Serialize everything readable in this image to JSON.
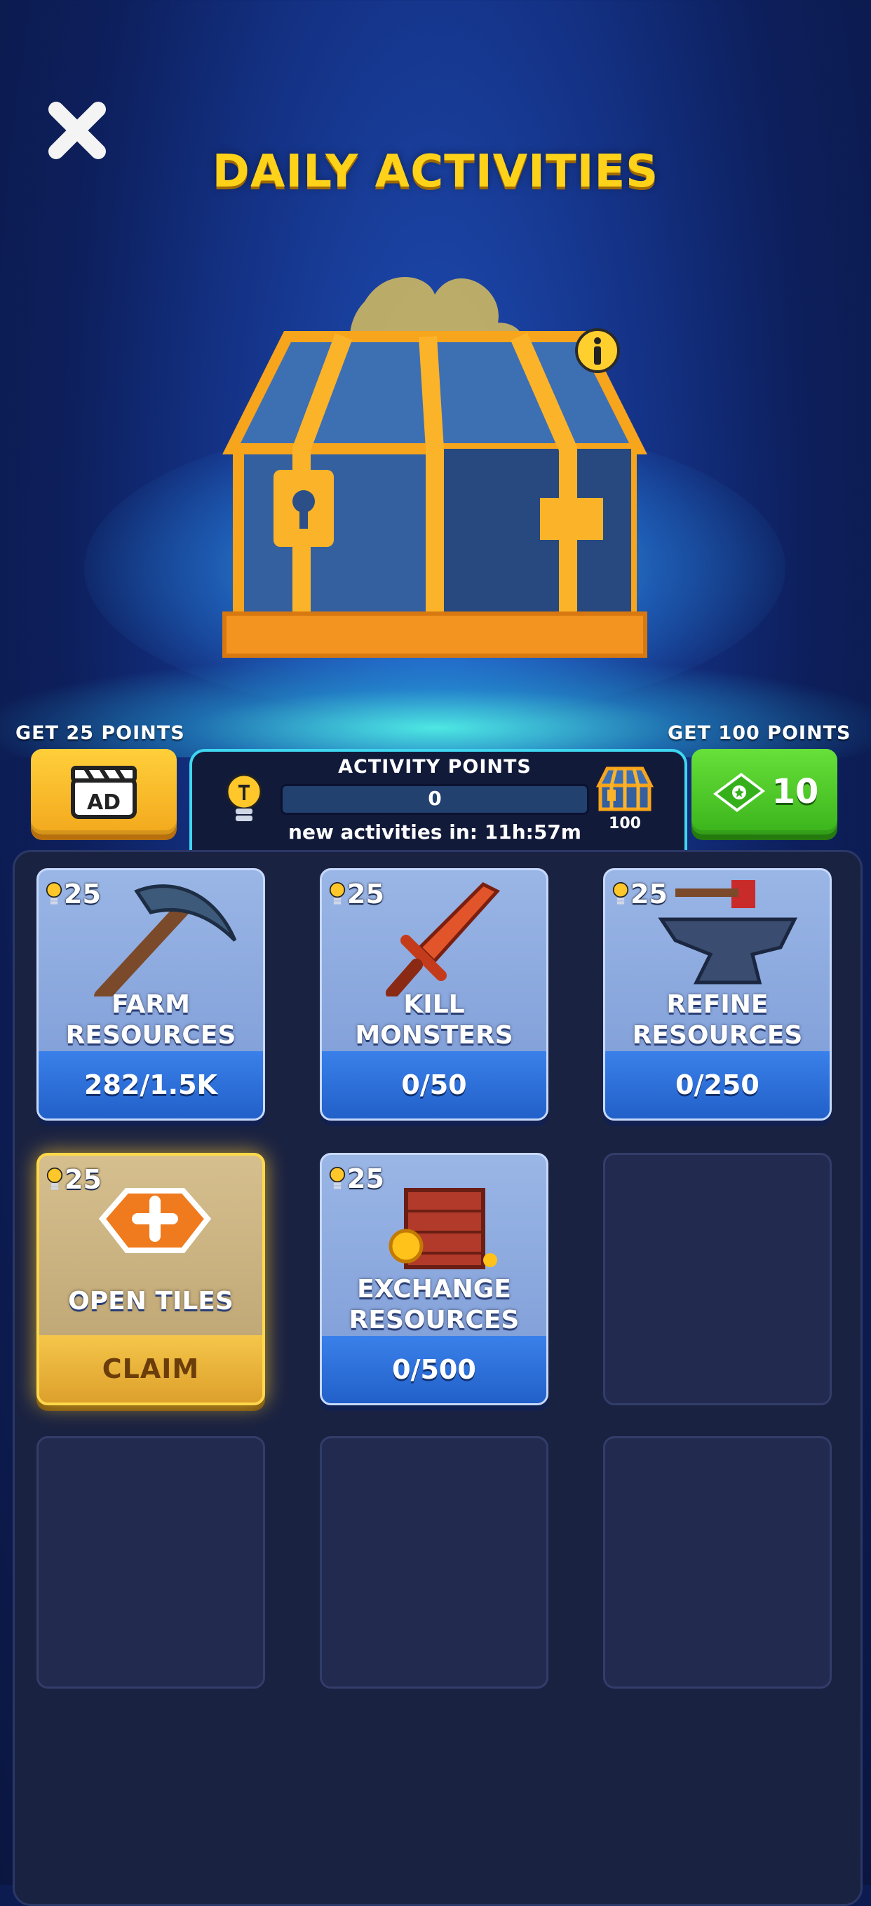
{
  "header": {
    "title": "DAILY ACTIVITIES",
    "close_icon": "close-icon"
  },
  "hero": {
    "chest_icon": "treasure-chest-icon",
    "info_icon": "info-icon"
  },
  "ad_offer": {
    "label": "GET 25 POINTS",
    "button_text": "AD",
    "icon": "ad-clapperboard-icon"
  },
  "cash_offer": {
    "label": "GET 100 POINTS",
    "price": "10",
    "icon": "cash-icon"
  },
  "activity_points": {
    "title": "ACTIVITY POINTS",
    "value": "0",
    "progress": 0,
    "timer": "new activities in: 11h:57m",
    "reward_target": "100",
    "icon": "lightbulb-icon"
  },
  "activities": [
    {
      "points": "25",
      "name": "FARM RESOURCES",
      "name_lines": [
        "FARM",
        "RESOURCES"
      ],
      "progress": "282/1.5K",
      "icon": "pickaxe-icon",
      "state": "active"
    },
    {
      "points": "25",
      "name": "KILL MONSTERS",
      "name_lines": [
        "KILL",
        "MONSTERS"
      ],
      "progress": "0/50",
      "icon": "sword-icon",
      "state": "active"
    },
    {
      "points": "25",
      "name": "REFINE RESOURCES",
      "name_lines": [
        "REFINE",
        "RESOURCES"
      ],
      "progress": "0/250",
      "icon": "anvil-icon",
      "state": "active"
    },
    {
      "points": "25",
      "name": "OPEN TILES",
      "name_lines": [
        "OPEN TILES"
      ],
      "progress": "CLAIM",
      "icon": "tile-icon",
      "state": "claim"
    },
    {
      "points": "25",
      "name": "EXCHANGE RESOURCES",
      "name_lines": [
        "EXCHANGE",
        "RESOURCES"
      ],
      "progress": "0/500",
      "icon": "crate-icon",
      "state": "active"
    }
  ],
  "colors": {
    "title": "#ffd21a",
    "accent_cyan": "#3fd6f0",
    "card_blue": "#2260c9",
    "claim_gold": "#f5c64a"
  }
}
